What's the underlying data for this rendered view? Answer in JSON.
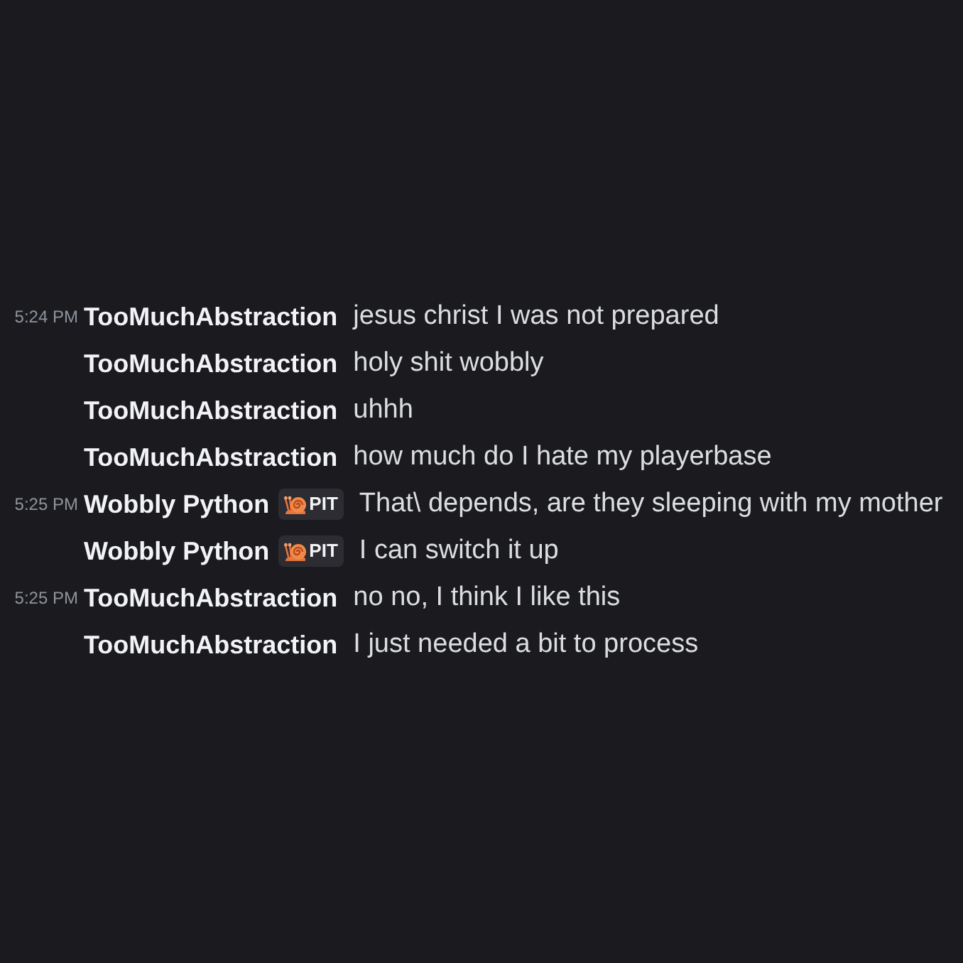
{
  "messages": [
    {
      "timestamp": "5:24 PM",
      "author": "TooMuchAbstraction",
      "text": "jesus christ I was not prepared"
    },
    {
      "author": "TooMuchAbstraction",
      "text": "holy shit wobbly"
    },
    {
      "author": "TooMuchAbstraction",
      "text": "uhhh"
    },
    {
      "author": "TooMuchAbstraction",
      "text": "how much do I hate my playerbase"
    },
    {
      "timestamp": "5:25 PM",
      "author": "Wobbly Python",
      "tag": {
        "label": "PIT"
      },
      "text": "That\\ depends, are they sleeping with my mother"
    },
    {
      "author": "Wobbly Python",
      "tag": {
        "label": "PIT"
      },
      "text": "I can switch it up"
    },
    {
      "timestamp": "5:25 PM",
      "author": "TooMuchAbstraction",
      "text": "no no, I think I like this"
    },
    {
      "author": "TooMuchAbstraction",
      "text": "I just needed a bit to process"
    }
  ]
}
